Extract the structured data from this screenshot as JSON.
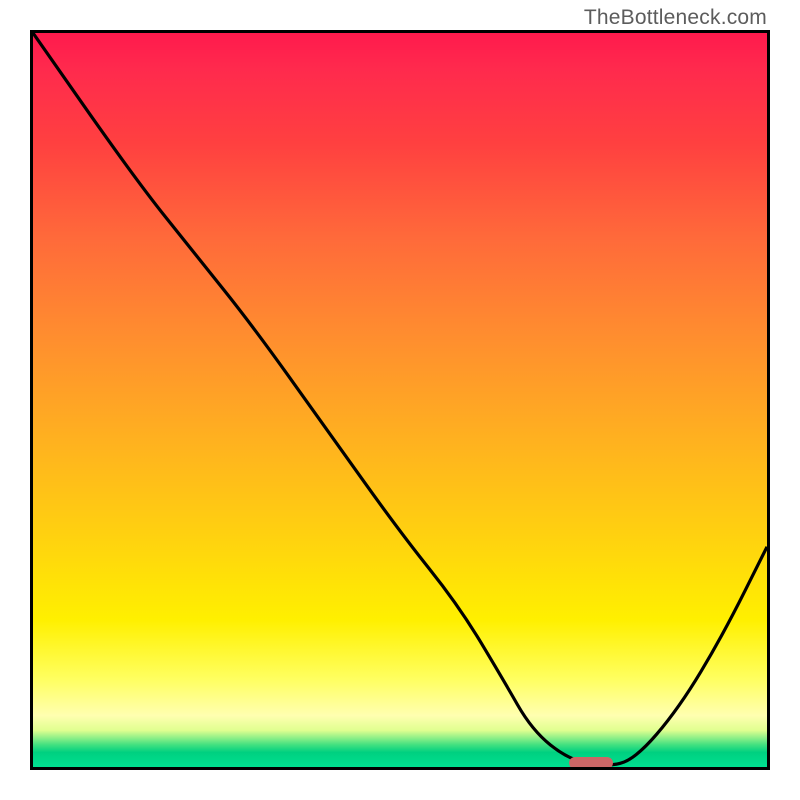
{
  "watermark": "TheBottleneck.com",
  "chart_data": {
    "type": "line",
    "title": "",
    "xlabel": "",
    "ylabel": "",
    "xlim": [
      0,
      100
    ],
    "ylim": [
      0,
      100
    ],
    "grid": false,
    "curve": {
      "name": "bottleneck-curve",
      "x": [
        0,
        14,
        22,
        30,
        40,
        50,
        58,
        64,
        68,
        73,
        78,
        82,
        88,
        94,
        100
      ],
      "y": [
        100,
        80,
        70,
        60,
        46,
        32,
        22,
        12,
        5,
        1,
        0,
        1,
        8,
        18,
        30
      ]
    },
    "marker": {
      "name": "optimum-marker",
      "x_start": 73,
      "x_end": 79,
      "y": 0.5,
      "color": "#cc6666"
    },
    "background_gradient": {
      "top": "#ff1a4d",
      "mid": "#ffd400",
      "bottom": "#00d080"
    }
  }
}
